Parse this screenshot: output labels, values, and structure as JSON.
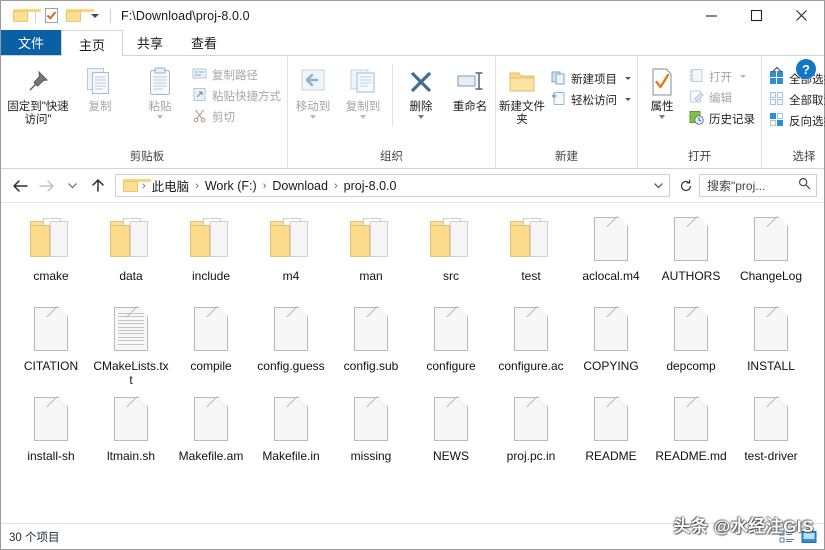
{
  "window": {
    "title": "F:\\Download\\proj-8.0.0",
    "quick_access": [
      {
        "name": "folder-icon",
        "label": ""
      },
      {
        "name": "properties-icon",
        "label": ""
      },
      {
        "name": "new-folder-icon",
        "label": ""
      }
    ],
    "controls": {
      "minimize": "–",
      "maximize": "□",
      "close": "✕"
    }
  },
  "tabs": [
    {
      "label": "文件",
      "kind": "file"
    },
    {
      "label": "主页",
      "kind": "active"
    },
    {
      "label": "共享",
      "kind": "normal"
    },
    {
      "label": "查看",
      "kind": "normal"
    }
  ],
  "ribbon": {
    "help_label": "?",
    "groups": [
      {
        "title": "剪贴板",
        "big": [
          {
            "label": "固定到\"快速访问\"",
            "icon": "pin-icon"
          },
          {
            "label": "复制",
            "icon": "copy-icon"
          },
          {
            "label": "粘贴",
            "icon": "paste-icon"
          }
        ],
        "small": [
          {
            "label": "复制路径",
            "icon": "copy-path-icon"
          },
          {
            "label": "粘贴快捷方式",
            "icon": "paste-shortcut-icon"
          },
          {
            "label": "剪切",
            "icon": "cut-icon"
          }
        ]
      },
      {
        "title": "组织",
        "big": [
          {
            "label": "移动到",
            "icon": "move-to-icon"
          },
          {
            "label": "复制到",
            "icon": "copy-to-icon"
          },
          {
            "label": "删除",
            "icon": "delete-icon"
          },
          {
            "label": "重命名",
            "icon": "rename-icon"
          }
        ],
        "small": []
      },
      {
        "title": "新建",
        "big": [
          {
            "label": "新建文件夹",
            "icon": "new-folder-icon"
          }
        ],
        "small": [
          {
            "label": "新建项目",
            "icon": "new-item-icon"
          },
          {
            "label": "轻松访问",
            "icon": "easy-access-icon"
          }
        ]
      },
      {
        "title": "打开",
        "big": [
          {
            "label": "属性",
            "icon": "properties-icon"
          }
        ],
        "small": [
          {
            "label": "打开",
            "icon": "open-icon"
          },
          {
            "label": "编辑",
            "icon": "edit-icon"
          },
          {
            "label": "历史记录",
            "icon": "history-icon"
          }
        ]
      },
      {
        "title": "选择",
        "big": [],
        "small": [
          {
            "label": "全部选择",
            "icon": "select-all-icon"
          },
          {
            "label": "全部取消",
            "icon": "select-none-icon"
          },
          {
            "label": "反向选择",
            "icon": "invert-selection-icon"
          }
        ]
      }
    ]
  },
  "address": {
    "breadcrumbs": [
      "此电脑",
      "Work (F:)",
      "Download",
      "proj-8.0.0"
    ],
    "separator": "›",
    "search_placeholder": "搜索\"proj..."
  },
  "files": [
    {
      "name": "cmake",
      "type": "folder"
    },
    {
      "name": "data",
      "type": "folder"
    },
    {
      "name": "include",
      "type": "folder"
    },
    {
      "name": "m4",
      "type": "folder"
    },
    {
      "name": "man",
      "type": "folder"
    },
    {
      "name": "src",
      "type": "folder"
    },
    {
      "name": "test",
      "type": "folder"
    },
    {
      "name": "aclocal.m4",
      "type": "file"
    },
    {
      "name": "AUTHORS",
      "type": "file"
    },
    {
      "name": "ChangeLog",
      "type": "file"
    },
    {
      "name": "CITATION",
      "type": "file"
    },
    {
      "name": "CMakeLists.txt",
      "type": "text"
    },
    {
      "name": "compile",
      "type": "file"
    },
    {
      "name": "config.guess",
      "type": "file"
    },
    {
      "name": "config.sub",
      "type": "file"
    },
    {
      "name": "configure",
      "type": "file"
    },
    {
      "name": "configure.ac",
      "type": "file"
    },
    {
      "name": "COPYING",
      "type": "file"
    },
    {
      "name": "depcomp",
      "type": "file"
    },
    {
      "name": "INSTALL",
      "type": "file"
    },
    {
      "name": "install-sh",
      "type": "file"
    },
    {
      "name": "ltmain.sh",
      "type": "file"
    },
    {
      "name": "Makefile.am",
      "type": "file"
    },
    {
      "name": "Makefile.in",
      "type": "file"
    },
    {
      "name": "missing",
      "type": "file"
    },
    {
      "name": "NEWS",
      "type": "file"
    },
    {
      "name": "proj.pc.in",
      "type": "file"
    },
    {
      "name": "README",
      "type": "file"
    },
    {
      "name": "README.md",
      "type": "file"
    },
    {
      "name": "test-driver",
      "type": "file"
    }
  ],
  "statusbar": {
    "item_count": "30 个项目",
    "view_buttons": [
      "details-view-icon",
      "large-icons-view-icon"
    ]
  },
  "watermark": "头条 @水经注GIS"
}
